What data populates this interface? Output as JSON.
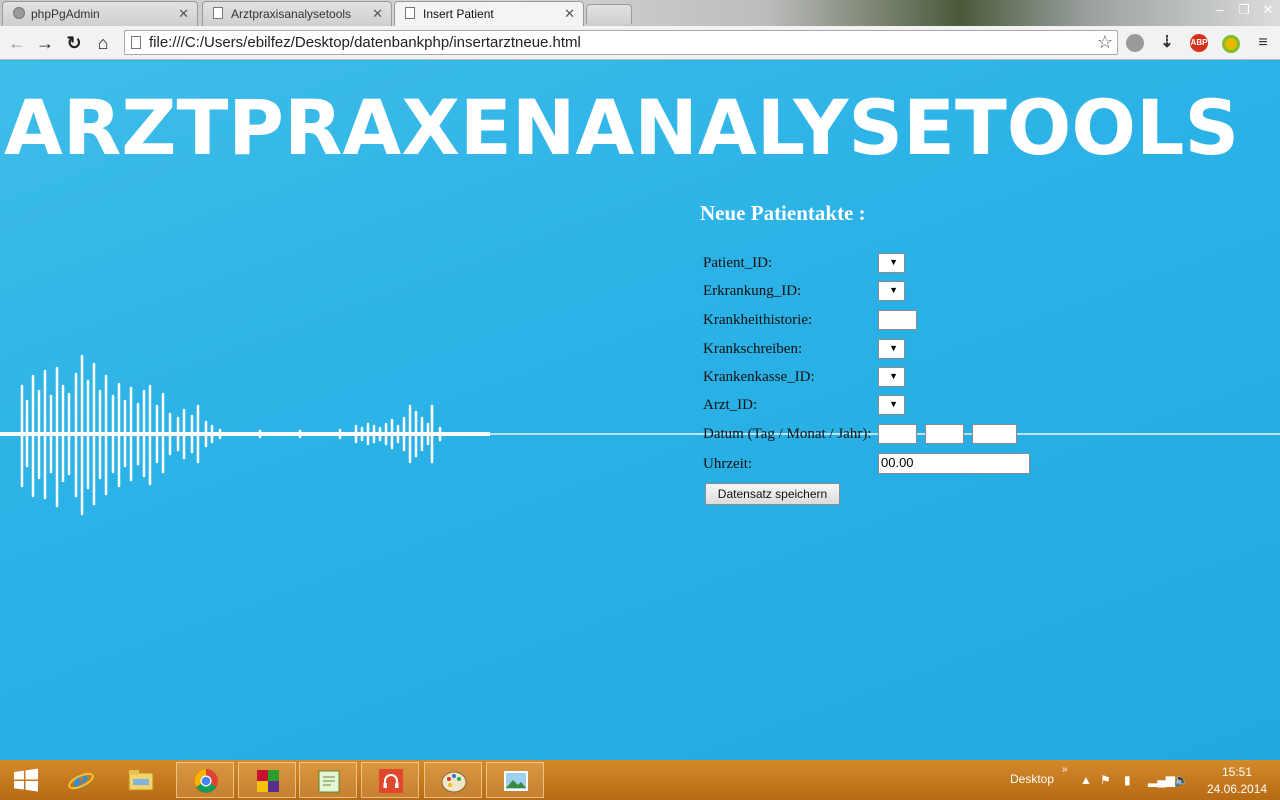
{
  "browser": {
    "tabs": [
      {
        "label": "phpPgAdmin",
        "active": false
      },
      {
        "label": "Arztpraxisanalysetools",
        "active": false
      },
      {
        "label": "Insert Patient",
        "active": true
      }
    ],
    "url": "file:///C:/Users/ebilfez/Desktop/datenbankphp/insertarztneue.html",
    "extensions": [
      {
        "name": "abp-icon",
        "text": "ABP",
        "color": "#d9301c"
      }
    ]
  },
  "page": {
    "heading": "ARZTPRAXENANALYSETOOLS",
    "form": {
      "title": "Neue Patientakte :",
      "fields": {
        "patient_id": "Patient_ID:",
        "erkrankung_id": "Erkrankung_ID:",
        "krankheitshistorie": "Krankheithistorie:",
        "krankschreiben": "Krankschreiben:",
        "krankenkasse_id": "Krankenkasse_ID:",
        "arzt_id": "Arzt_ID:",
        "datum": "Datum (Tag / Monat / Jahr):",
        "uhrzeit": "Uhrzeit:"
      },
      "uhrzeit_value": "00.00",
      "submit_label": "Datensatz speichern"
    }
  },
  "taskbar": {
    "desktop_label": "Desktop",
    "time": "15:51",
    "date": "24.06.2014",
    "apps": [
      "start-button",
      "internet-explorer-icon",
      "file-explorer-icon",
      "chrome-icon",
      "winrar-icon",
      "notepad-plus-plus-icon",
      "music-player-icon",
      "paint-icon",
      "photo-viewer-icon"
    ]
  },
  "colors": {
    "page_background": "#2bb3e6",
    "heading": "#ffffff",
    "taskbar": "#c57a1f"
  }
}
